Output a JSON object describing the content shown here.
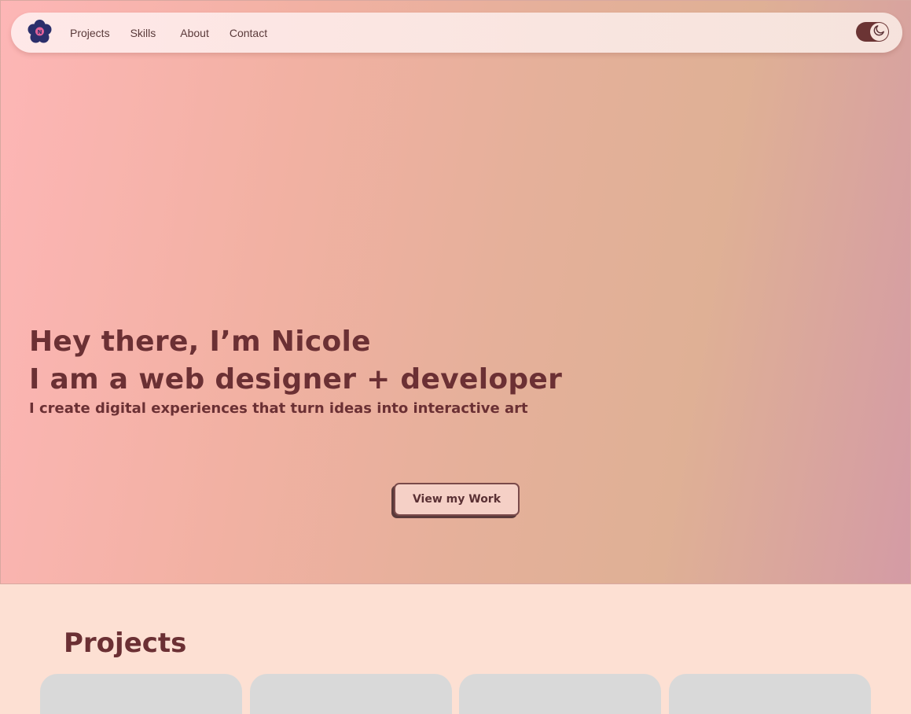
{
  "nav": {
    "logo_icon": "flower-logo-icon",
    "logo_letter": "N",
    "links": [
      {
        "label": "Projects"
      },
      {
        "label": "Skills"
      },
      {
        "label": "About"
      },
      {
        "label": "Contact"
      }
    ],
    "theme_toggle_icon": "moon-icon",
    "theme_toggle_on": true
  },
  "hero": {
    "line1": "Hey there, I’m Nicole",
    "line2": "I am a web designer + developer",
    "subtitle": "I create digital experiences that turn ideas into interactive art",
    "cta_label": "View my Work"
  },
  "projects": {
    "title": "Projects",
    "card_count": 4
  },
  "colors": {
    "text_primary": "#6b3034",
    "toggle_bg": "#6b3434",
    "logo_petals": "#2b2f6b",
    "logo_center": "#e0629a",
    "section_bg": "#fde0d3",
    "card_bg": "#d9d9d9"
  }
}
